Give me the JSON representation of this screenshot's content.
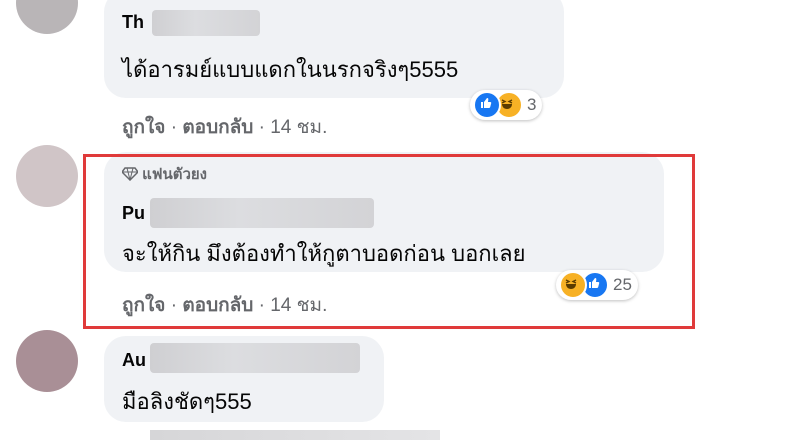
{
  "comments": [
    {
      "name": "Th",
      "text": "ได้อารมย์แบบแดกในนรกจริงๆ5555",
      "actions": {
        "like": "ถูกใจ",
        "reply": "ตอบกลับ",
        "time": "14 ชม."
      },
      "reactions": {
        "icons": [
          "like-icon",
          "haha-icon"
        ],
        "count": "3"
      }
    },
    {
      "badge": "แฟนตัวยง",
      "name": "Pu",
      "text": "จะให้กิน มึงต้องทำให้กูตาบอดก่อน บอกเลย",
      "actions": {
        "like": "ถูกใจ",
        "reply": "ตอบกลับ",
        "time": "14 ชม."
      },
      "reactions": {
        "icons": [
          "haha-icon",
          "like-icon"
        ],
        "count": "25"
      }
    },
    {
      "name": "Au",
      "text": "มือลิงชัดๆ555"
    }
  ],
  "separator": "·",
  "colors": {
    "like": "#1877f2",
    "haha": "#f7b125",
    "highlight": "#e03a3a",
    "bubble": "#f0f2f5"
  }
}
